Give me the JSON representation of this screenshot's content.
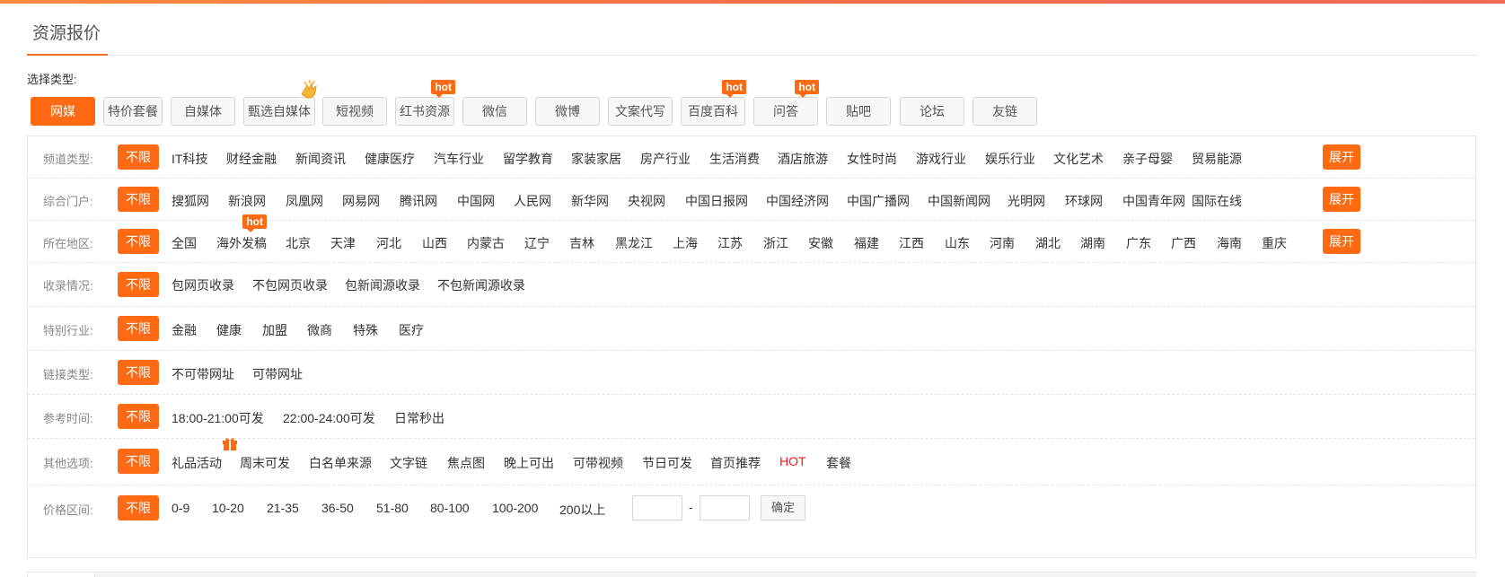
{
  "page_title": "资源报价",
  "type_label": "选择类型:",
  "types": [
    {
      "label": "网媒",
      "active": true
    },
    {
      "label": "特价套餐"
    },
    {
      "label": "自媒体"
    },
    {
      "label": "甄选自媒体",
      "icon": "hand-icon"
    },
    {
      "label": "短视频"
    },
    {
      "label": "红书资源",
      "hot": "hot"
    },
    {
      "label": "微信"
    },
    {
      "label": "微博"
    },
    {
      "label": "文案代写"
    },
    {
      "label": "百度百科",
      "hot": "hot"
    },
    {
      "label": "问答",
      "hot": "hot"
    },
    {
      "label": "贴吧"
    },
    {
      "label": "论坛"
    },
    {
      "label": "友链"
    }
  ],
  "unlimited_label": "不限",
  "expand_label": "展开",
  "filters": {
    "channel": {
      "label": "频道类型:",
      "options": [
        "IT科技",
        "财经金融",
        "新闻资讯",
        "健康医疗",
        "汽车行业",
        "留学教育",
        "家装家居",
        "房产行业",
        "生活消费",
        "酒店旅游",
        "女性时尚",
        "游戏行业",
        "娱乐行业",
        "文化艺术",
        "亲子母婴",
        "贸易能源"
      ]
    },
    "portal": {
      "label": "综合门户:",
      "options": [
        "搜狐网",
        "新浪网",
        "凤凰网",
        "网易网",
        "腾讯网",
        "中国网",
        "人民网",
        "新华网",
        "央视网",
        "中国日报网",
        "中国经济网",
        "中国广播网",
        "中国新闻网",
        "光明网",
        "环球网",
        "中国青年网",
        "国际在线"
      ]
    },
    "region": {
      "label": "所在地区:",
      "hot_tag": "hot",
      "options": [
        "全国",
        "海外发稿",
        "北京",
        "天津",
        "河北",
        "山西",
        "内蒙古",
        "辽宁",
        "吉林",
        "黑龙江",
        "上海",
        "江苏",
        "浙江",
        "安徽",
        "福建",
        "江西",
        "山东",
        "河南",
        "湖北",
        "湖南",
        "广东",
        "广西",
        "海南",
        "重庆"
      ]
    },
    "indexing": {
      "label": "收录情况:",
      "options": [
        "包网页收录",
        "不包网页收录",
        "包新闻源收录",
        "不包新闻源收录"
      ]
    },
    "industry": {
      "label": "特别行业:",
      "options": [
        "金融",
        "健康",
        "加盟",
        "微商",
        "特殊",
        "医疗"
      ]
    },
    "link": {
      "label": "链接类型:",
      "options": [
        "不可带网址",
        "可带网址"
      ]
    },
    "time": {
      "label": "参考时间:",
      "options": [
        "18:00-21:00可发",
        "22:00-24:00可发",
        "日常秒出"
      ]
    },
    "other": {
      "label": "其他选项:",
      "options": [
        "礼品活动",
        "周末可发",
        "白名单来源",
        "文字链",
        "焦点图",
        "晚上可出",
        "可带视频",
        "节日可发",
        "首页推荐",
        "HOT",
        "套餐"
      ]
    },
    "price": {
      "label": "价格区间:",
      "options": [
        "0-9",
        "10-20",
        "21-35",
        "36-50",
        "51-80",
        "80-100",
        "100-200",
        "200以上"
      ],
      "separator": "-",
      "confirm_label": "确定"
    }
  },
  "colors": {
    "accent": "#ff6a12",
    "hot_text": "#ff1a1a"
  }
}
